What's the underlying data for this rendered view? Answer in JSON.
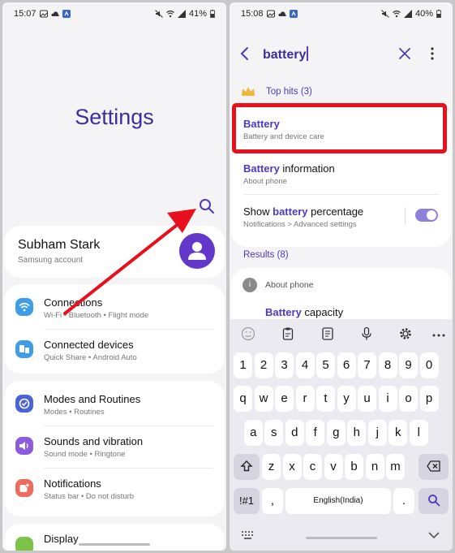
{
  "left": {
    "status": {
      "time": "15:07",
      "battery": "41%"
    },
    "title": "Settings",
    "profile": {
      "name": "Subham Stark",
      "subtitle": "Samsung account"
    },
    "group1": [
      {
        "title": "Connections",
        "subtitle": "Wi-Fi  •  Bluetooth  •  Flight mode",
        "icon": "wifi-icon",
        "color": "#3e9de8"
      },
      {
        "title": "Connected devices",
        "subtitle": "Quick Share  •  Android Auto",
        "icon": "devices-icon",
        "color": "#3e9de8"
      }
    ],
    "group2": [
      {
        "title": "Modes and Routines",
        "subtitle": "Modes  •  Routines",
        "icon": "check-circle-icon",
        "color": "#4b62d9"
      },
      {
        "title": "Sounds and vibration",
        "subtitle": "Sound mode  •  Ringtone",
        "icon": "volume-icon",
        "color": "#8b5dde"
      },
      {
        "title": "Notifications",
        "subtitle": "Status bar  •  Do not disturb",
        "icon": "bell-icon",
        "color": "#ee6a5d"
      }
    ],
    "group3": [
      {
        "title": "Display",
        "icon": "display-icon",
        "color": "#7dc34a"
      }
    ]
  },
  "right": {
    "status": {
      "time": "15:08",
      "battery": "40%"
    },
    "search": {
      "query": "battery"
    },
    "top_hits_label": "Top hits (3)",
    "hits": [
      {
        "keyword": "Battery",
        "rest": "",
        "subtitle": "Battery and device care"
      },
      {
        "keyword": "Battery",
        "rest": " information",
        "subtitle": "About phone"
      },
      {
        "prefix": "Show ",
        "keyword": "battery",
        "rest": " percentage",
        "subtitle": "Notifications > Advanced settings",
        "toggle": true
      }
    ],
    "results_label": "Results (8)",
    "result_group": {
      "label": "About phone",
      "item_keyword": "Battery",
      "item_rest": " capacity"
    },
    "keyboard": {
      "row1": [
        "1",
        "2",
        "3",
        "4",
        "5",
        "6",
        "7",
        "8",
        "9",
        "0"
      ],
      "row2": [
        "q",
        "w",
        "e",
        "r",
        "t",
        "y",
        "u",
        "i",
        "o",
        "p"
      ],
      "row3": [
        "a",
        "s",
        "d",
        "f",
        "g",
        "h",
        "j",
        "k",
        "l"
      ],
      "row4": [
        "z",
        "x",
        "c",
        "v",
        "b",
        "n",
        "m"
      ],
      "symbols_key": "!#1",
      "comma": ",",
      "space": "English(India)",
      "period": "."
    }
  },
  "colors": {
    "accent": "#3f2d9c",
    "highlight": "#e8101c",
    "arrow": "#e8101c"
  }
}
